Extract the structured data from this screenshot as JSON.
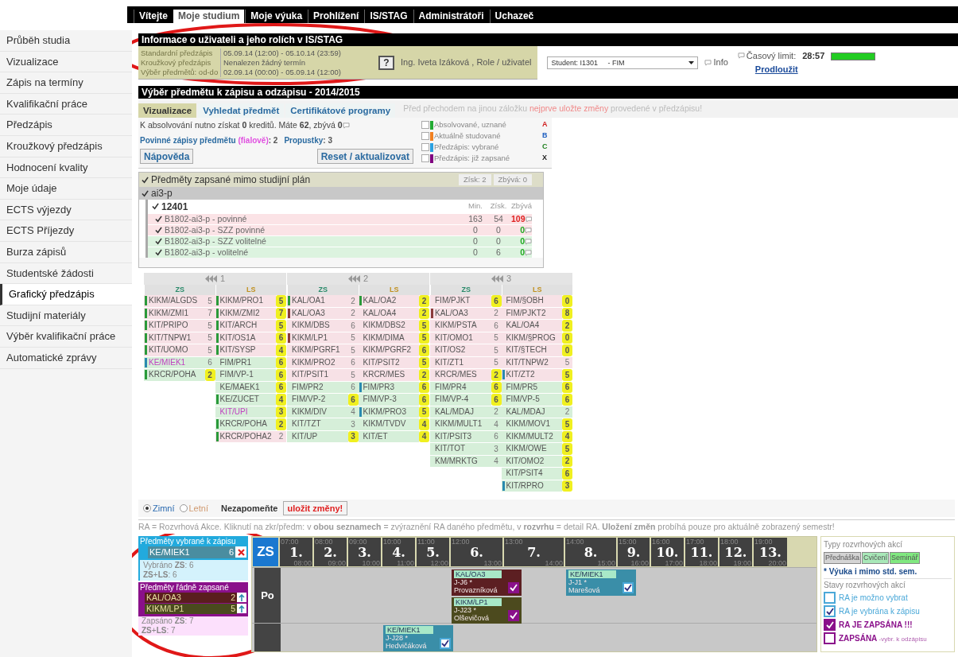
{
  "nav": {
    "tabs": [
      {
        "label": "Vítejte",
        "selected": false
      },
      {
        "label": "Moje studium",
        "selected": true
      },
      {
        "label": "Moje výuka",
        "selected": false
      },
      {
        "label": "Prohlížení",
        "selected": false
      },
      {
        "label": "IS/STAG",
        "selected": false
      },
      {
        "label": "Administrátoři",
        "selected": false
      },
      {
        "label": "Uchazeč",
        "selected": false
      }
    ]
  },
  "sidebar": {
    "items": [
      {
        "label": "Průběh studia",
        "selected": false
      },
      {
        "label": "Vizualizace",
        "selected": false
      },
      {
        "label": "Zápis na termíny",
        "selected": false
      },
      {
        "label": "Kvalifikační práce",
        "selected": false
      },
      {
        "label": "Předzápis",
        "selected": false
      },
      {
        "label": "Kroužkový předzápis",
        "selected": false
      },
      {
        "label": "Hodnocení kvality",
        "selected": false
      },
      {
        "label": "Moje údaje",
        "selected": false
      },
      {
        "label": "ECTS výjezdy",
        "selected": false
      },
      {
        "label": "ECTS Příjezdy",
        "selected": false
      },
      {
        "label": "Burza zápisů",
        "selected": false
      },
      {
        "label": "Studentské žádosti",
        "selected": false
      },
      {
        "label": "Grafický předzápis",
        "selected": true
      },
      {
        "label": "Studijní materiály",
        "selected": false
      },
      {
        "label": "Výběr kvalifikační práce",
        "selected": false
      },
      {
        "label": "Automatické zprávy",
        "selected": false
      }
    ]
  },
  "user_info": {
    "title": "Informace o uživateli a jeho rolích v IS/STAG",
    "periods": [
      {
        "label": "Standardní předzápis",
        "value": "05.09.14 (12:00) - 05.10.14 (23:59)"
      },
      {
        "label": "Kroužkový předzápis",
        "value": "Nenalezen žádný termín"
      },
      {
        "label": "Výběr předmětů: od-do",
        "value": "02.09.14 (00:00) - 05.09.14 (12:00)"
      }
    ],
    "help": "?",
    "user": "Ing. Iveta Izáková , Role / uživatel",
    "role_select": {
      "value": "Student: I1301     - FIM"
    },
    "info_link": "Info",
    "time_limit_label": "Časový limit:",
    "time_limit": "28:57",
    "time_bar": {
      "level": 1
    },
    "extend_link": "Prodloužit"
  },
  "selection": {
    "title": "Výběr předmětu k zápisu a odzápisu - 2014/2015",
    "tabs": [
      {
        "label": "Vizualizace",
        "selected": true
      },
      {
        "label": "Vyhledat předmět",
        "selected": false
      },
      {
        "label": "Certifikátové programy",
        "selected": false
      }
    ],
    "notice": {
      "before": "Před přechodem na jinou záložku",
      "highlight": "nejprve uložte změny",
      "after": "provedené v předzápisu!"
    },
    "credits_text": "K absolvování nutno získat **0** kreditů. Máte **62**, zbývá **0**",
    "required": {
      "label": "Povinné zápisy předmětu",
      "hint": "(fialově)",
      "value": ": 2"
    },
    "passes": {
      "label": "Propustky",
      "value": ": 3"
    },
    "buttons": [
      "Nápověda",
      "Reset / aktualizovat"
    ],
    "legend": [
      {
        "label": "Absolvované, uznané",
        "color": "#22aa33",
        "checked": false,
        "letter": "A"
      },
      {
        "label": "Aktuálně studované",
        "color": "#f08020",
        "checked": false,
        "letter": "B"
      },
      {
        "label": "Předzápis: vybrané",
        "color": "#2aa0e0",
        "checked": false,
        "letter": "C"
      },
      {
        "label": "Předzápis: již zapsané",
        "color": "#800080",
        "checked": false,
        "letter": "X"
      }
    ]
  },
  "tree": {
    "outside": {
      "label": "Předměty zapsané mimo studijní plán",
      "checked": true,
      "earned": "Získ: 2",
      "remaining": "Zbývá: 0"
    },
    "plan": {
      "label": "ai3-p",
      "checked": true
    },
    "block": {
      "label": "12401",
      "checked": true,
      "columns": [
        "Min.",
        "Získ.",
        "Zbývá"
      ],
      "rows": [
        {
          "label": "B1802-ai3-p - povinné",
          "checked": true,
          "color": "#fbe3e6",
          "min": "163",
          "earned": "54",
          "remaining": "109",
          "complete": false
        },
        {
          "label": "B1802-ai3-p - SZZ povinné",
          "checked": true,
          "color": "#fbe3e6",
          "min": "0",
          "earned": "0",
          "remaining": "0",
          "complete": true
        },
        {
          "label": "B1802-ai3-p - SZZ volitelné",
          "checked": true,
          "color": "#dcf3df",
          "min": "0",
          "earned": "0",
          "remaining": "0",
          "complete": true
        },
        {
          "label": "B1802-ai3-p - volitelné",
          "checked": true,
          "color": "#dcf3df",
          "min": "0",
          "earned": "6",
          "remaining": "0",
          "complete": true
        }
      ]
    }
  },
  "grid": {
    "years": [
      {
        "label": "1",
        "semesters": [
          {
            "label": "ZS",
            "courses": [
              {
                "code": "KIKM/ALGDS",
                "credits": "5",
                "color": "#f7e1e6",
                "badge": false,
                "marker": {
                  "color": "#2a9a3a"
                }
              },
              {
                "code": "KIKM/ZMI1",
                "credits": "7",
                "color": "#f7e1e6",
                "badge": false,
                "marker": {
                  "color": "#2a9a3a"
                }
              },
              {
                "code": "KIT/PRIPO",
                "credits": "5",
                "color": "#f7e1e6",
                "badge": false,
                "marker": {
                  "color": "#2a9a3a"
                }
              },
              {
                "code": "KIT/TNPW1",
                "credits": "5",
                "color": "#f7e1e6",
                "badge": false,
                "marker": {
                  "color": "#2a9a3a"
                }
              },
              {
                "code": "KIT/UOMO",
                "credits": "5",
                "color": "#f7e1e6",
                "badge": false,
                "marker": {
                  "color": "#2a9a3a"
                }
              },
              {
                "code": "KE/MIEK1",
                "credits": "6",
                "color": "#d6efd9",
                "badge": false,
                "marker": {
                  "color": "#2a8ab0"
                },
                "emphasis": true
              },
              {
                "code": "KRCR/POHA",
                "credits": "2",
                "color": "#d6efd9",
                "badge": true,
                "marker": {
                  "color": "#2a9a3a"
                }
              }
            ]
          },
          {
            "label": "LS",
            "courses": [
              {
                "code": "KIKM/PRO1",
                "credits": "5",
                "color": "#f7e1e6",
                "badge": true,
                "marker": {
                  "color": "#2a9a3a"
                }
              },
              {
                "code": "KIKM/ZMI2",
                "credits": "7",
                "color": "#f7e1e6",
                "badge": true,
                "marker": {
                  "color": "#2a9a3a"
                }
              },
              {
                "code": "KIT/ARCH",
                "credits": "5",
                "color": "#f7e1e6",
                "badge": true,
                "marker": {
                  "color": "#2a9a3a"
                }
              },
              {
                "code": "KIT/OS1A",
                "credits": "6",
                "color": "#f7e1e6",
                "badge": true,
                "marker": {
                  "color": "#2a9a3a"
                }
              },
              {
                "code": "KIT/SYSP",
                "credits": "4",
                "color": "#f7e1e6",
                "badge": true,
                "marker": {
                  "color": "#2a9a3a"
                }
              },
              {
                "code": "FIM/PR1",
                "credits": "6",
                "color": "#d6efd9",
                "badge": true
              },
              {
                "code": "FIM/VP-1",
                "credits": "6",
                "color": "#d6efd9",
                "badge": true
              },
              {
                "code": "KE/MAEK1",
                "credits": "6",
                "color": "#d6efd9",
                "badge": true
              },
              {
                "code": "KE/ZUCET",
                "credits": "4",
                "color": "#d6efd9",
                "badge": true,
                "marker": {
                  "color": "#2a9a3a"
                }
              },
              {
                "code": "KIT/UPI",
                "credits": "3",
                "color": "#d6efd9",
                "badge": true,
                "emphasis": true
              },
              {
                "code": "KRCR/POHA",
                "credits": "2",
                "color": "#d6efd9",
                "badge": true,
                "marker": {
                  "color": "#2a9a3a"
                }
              },
              {
                "code": "KRCR/POHA2",
                "credits": "2",
                "color": "#f7e1e6",
                "badge": false,
                "marker": {
                  "color": "#2a9a3a"
                }
              }
            ]
          }
        ]
      },
      {
        "label": "2",
        "semesters": [
          {
            "label": "ZS",
            "courses": [
              {
                "code": "KAL/OA1",
                "credits": "2",
                "color": "#f7e1e6",
                "badge": false,
                "marker": {
                  "color": "#2a9a3a"
                }
              },
              {
                "code": "KAL/OA3",
                "credits": "2",
                "color": "#f7e1e6",
                "badge": false,
                "marker": {
                  "color": "#8a3a3a"
                }
              },
              {
                "code": "KIKM/DBS",
                "credits": "6",
                "color": "#f7e1e6",
                "badge": false
              },
              {
                "code": "KIKM/LP1",
                "credits": "5",
                "color": "#f7e1e6",
                "badge": false,
                "marker": {
                  "color": "#8a3a3a"
                }
              },
              {
                "code": "KIKM/PGRF1",
                "credits": "5",
                "color": "#f7e1e6",
                "badge": false
              },
              {
                "code": "KIKM/PRO2",
                "credits": "6",
                "color": "#f7e1e6",
                "badge": false
              },
              {
                "code": "KIT/PSIT1",
                "credits": "5",
                "color": "#f7e1e6",
                "badge": false
              },
              {
                "code": "FIM/PR2",
                "credits": "6",
                "color": "#d6efd9",
                "badge": false
              },
              {
                "code": "FIM/VP-2",
                "credits": "6",
                "color": "#d6efd9",
                "badge": true
              },
              {
                "code": "KIKM/DIV",
                "credits": "4",
                "color": "#d6efd9",
                "badge": false
              },
              {
                "code": "KIT/TZT",
                "credits": "3",
                "color": "#d6efd9",
                "badge": false
              },
              {
                "code": "KIT/UP",
                "credits": "3",
                "color": "#d6efd9",
                "badge": true
              }
            ]
          },
          {
            "label": "LS",
            "courses": [
              {
                "code": "KAL/OA2",
                "credits": "2",
                "color": "#f7e1e6",
                "badge": true,
                "marker": {
                  "color": "#2a9a3a"
                }
              },
              {
                "code": "KAL/OA4",
                "credits": "2",
                "color": "#f7e1e6",
                "badge": true
              },
              {
                "code": "KIKM/DBS2",
                "credits": "5",
                "color": "#f7e1e6",
                "badge": true
              },
              {
                "code": "KIKM/DIMA",
                "credits": "5",
                "color": "#f7e1e6",
                "badge": true
              },
              {
                "code": "KIKM/PGRF2",
                "credits": "6",
                "color": "#f7e1e6",
                "badge": true
              },
              {
                "code": "KIT/PSIT2",
                "credits": "5",
                "color": "#f7e1e6",
                "badge": true
              },
              {
                "code": "KRCR/MES",
                "credits": "2",
                "color": "#f7e1e6",
                "badge": true
              },
              {
                "code": "FIM/PR3",
                "credits": "6",
                "color": "#d6efd9",
                "badge": true,
                "marker": {
                  "color": "#2a8ab0"
                }
              },
              {
                "code": "FIM/VP-3",
                "credits": "6",
                "color": "#d6efd9",
                "badge": true
              },
              {
                "code": "KIKM/PRO3",
                "credits": "5",
                "color": "#d6efd9",
                "badge": true,
                "marker": {
                  "color": "#2a8ab0"
                }
              },
              {
                "code": "KIKM/TVDV",
                "credits": "4",
                "color": "#d6efd9",
                "badge": true
              },
              {
                "code": "KIT/ET",
                "credits": "4",
                "color": "#d6efd9",
                "badge": true
              }
            ]
          }
        ]
      },
      {
        "label": "3",
        "semesters": [
          {
            "label": "ZS",
            "courses": [
              {
                "code": "FIM/PJKT",
                "credits": "6",
                "color": "#f7e1e6",
                "badge": true
              },
              {
                "code": "KAL/OA3",
                "credits": "2",
                "color": "#f7e1e6",
                "badge": false,
                "marker": {
                  "color": "#8a3a3a"
                }
              },
              {
                "code": "KIKM/PSTA",
                "credits": "6",
                "color": "#f7e1e6",
                "badge": false
              },
              {
                "code": "KIT/OMO1",
                "credits": "5",
                "color": "#f7e1e6",
                "badge": false
              },
              {
                "code": "KIT/OS2",
                "credits": "5",
                "color": "#f7e1e6",
                "badge": false
              },
              {
                "code": "KIT/ZT1",
                "credits": "5",
                "color": "#f7e1e6",
                "badge": false
              },
              {
                "code": "KRCR/MES",
                "credits": "2",
                "color": "#f7e1e6",
                "badge": true
              },
              {
                "code": "FIM/PR4",
                "credits": "6",
                "color": "#d6efd9",
                "badge": true
              },
              {
                "code": "FIM/VP-4",
                "credits": "6",
                "color": "#d6efd9",
                "badge": true
              },
              {
                "code": "KAL/MDAJ",
                "credits": "2",
                "color": "#d6efd9",
                "badge": false
              },
              {
                "code": "KIKM/MULT1",
                "credits": "4",
                "color": "#d6efd9",
                "badge": false
              },
              {
                "code": "KIT/PSIT3",
                "credits": "6",
                "color": "#d6efd9",
                "badge": false
              },
              {
                "code": "KIT/TOT",
                "credits": "3",
                "color": "#d6efd9",
                "badge": false
              },
              {
                "code": "KM/MRKTG",
                "credits": "4",
                "color": "#d6efd9",
                "badge": false
              }
            ]
          },
          {
            "label": "LS",
            "courses": [
              {
                "code": "FIM/§OBH",
                "credits": "0",
                "color": "#f7e1e6",
                "badge": true
              },
              {
                "code": "FIM/PJKT2",
                "credits": "8",
                "color": "#f7e1e6",
                "badge": true
              },
              {
                "code": "KAL/OA4",
                "credits": "2",
                "color": "#f7e1e6",
                "badge": true
              },
              {
                "code": "KIKM/§PROG",
                "credits": "0",
                "color": "#f7e1e6",
                "badge": true
              },
              {
                "code": "KIT/§TECH",
                "credits": "0",
                "color": "#f7e1e6",
                "badge": true
              },
              {
                "code": "KIT/TNPW2",
                "credits": "5",
                "color": "#f7e1e6",
                "badge": false
              },
              {
                "code": "KIT/ZT2",
                "credits": "5",
                "color": "#f7e1e6",
                "badge": true,
                "marker": {
                  "color": "#2a8ab0"
                }
              },
              {
                "code": "FIM/PR5",
                "credits": "6",
                "color": "#d6efd9",
                "badge": true
              },
              {
                "code": "FIM/VP-5",
                "credits": "6",
                "color": "#d6efd9",
                "badge": true
              },
              {
                "code": "KAL/MDAJ",
                "credits": "2",
                "color": "#d6efd9",
                "badge": false
              },
              {
                "code": "KIKM/MOV1",
                "credits": "5",
                "color": "#d6efd9",
                "badge": true
              },
              {
                "code": "KIKM/MULT2",
                "credits": "4",
                "color": "#d6efd9",
                "badge": true
              },
              {
                "code": "KIKM/OWE",
                "credits": "5",
                "color": "#d6efd9",
                "badge": true
              },
              {
                "code": "KIT/OMO2",
                "credits": "2",
                "color": "#d6efd9",
                "badge": true
              },
              {
                "code": "KIT/PSIT4",
                "credits": "6",
                "color": "#d6efd9",
                "badge": true
              },
              {
                "code": "KIT/RPRO",
                "credits": "3",
                "color": "#d6efd9",
                "badge": true,
                "marker": {
                  "color": "#2a8ab0"
                }
              }
            ]
          }
        ]
      }
    ]
  },
  "semester_choice": {
    "options": [
      {
        "label": "Zimní",
        "selected": true
      },
      {
        "label": "Letní",
        "selected": false
      }
    ],
    "reminder": "Nezapomeňte",
    "save_button": "uložit změny!"
  },
  "hint": "RA = Rozvrhová Akce. Kliknutí na zkr/předm: v **obou seznamech** = zvýraznění RA daného předmětu, v **rozvrhu** = detail RA. **Uložení změn** probíhá pouze pro aktuálně zobrazený semestr!",
  "schedule": {
    "chosen": {
      "title": "Předměty vybrané k zápisu",
      "items": [
        {
          "code": "KE/MIEK1",
          "credits": "6",
          "color": "#4a8da0"
        }
      ],
      "summary": [
        "Vybráno **ZS**: 6",
        "**ZS**+**LS**: 6"
      ]
    },
    "enrolled": {
      "title": "Předměty řádně zapsané",
      "items": [
        {
          "code": "KAL/OA3",
          "credits": "2",
          "color": "#5a1e1e"
        },
        {
          "code": "KIKM/LP1",
          "credits": "5",
          "color": "#4a4a1e"
        }
      ],
      "summary": [
        "Zapsáno **ZS**: 7",
        "**ZS**+**LS**: 7"
      ]
    },
    "semester": "ZS",
    "hours": [
      {
        "label": "1.",
        "start": "07:00",
        "end": "08:00"
      },
      {
        "label": "2.",
        "start": "08:00",
        "end": "09:00"
      },
      {
        "label": "3.",
        "start": "09:00",
        "end": "10:00"
      },
      {
        "label": "4.",
        "start": "10:00",
        "end": "11:00"
      },
      {
        "label": "5.",
        "start": "11:00",
        "end": "12:00"
      },
      {
        "label": "6.",
        "start": "12:00",
        "end": "13:00"
      },
      {
        "label": "7.",
        "start": "13:00",
        "end": "14:00"
      },
      {
        "label": "8.",
        "start": "14:00",
        "end": "15:00"
      },
      {
        "label": "9.",
        "start": "15:00",
        "end": "16:00"
      },
      {
        "label": "10.",
        "start": "16:00",
        "end": "17:00"
      },
      {
        "label": "11.",
        "start": "17:00",
        "end": "18:00"
      },
      {
        "label": "12.",
        "start": "18:00",
        "end": "19:00"
      },
      {
        "label": "13.",
        "start": "19:00",
        "end": "20:00"
      }
    ],
    "days": [
      {
        "label": "Po",
        "events": [
          {
            "code": "KAL/OA3",
            "room": "J-J6 *",
            "teacher": "Provazníková",
            "kind": "enrolled",
            "color": "#5c1f22"
          },
          {
            "code": "KIKM/LP1",
            "room": "J-J23 *",
            "teacher": "Olševičová",
            "kind": "enrolled",
            "color": "#4c4a1e"
          },
          {
            "code": "KE/MIEK1",
            "room": "J-J1 *",
            "teacher": "Marešová",
            "kind": "selected",
            "color": "#3a8ea8"
          }
        ]
      },
      {
        "events": [
          {
            "code": "KE/MIEK1",
            "room": "J-J28 *",
            "teacher": "Hedvičáková",
            "kind": "selected",
            "color": "#3a8ea8"
          }
        ]
      }
    ],
    "legend": {
      "types_title": "Typy rozvrhových akcí",
      "types": [
        {
          "label": "Přednáška",
          "color": "#d4d4d4"
        },
        {
          "label": "Cvičení",
          "color": "#a8e8b8"
        },
        {
          "label": "Seminář",
          "color": "#80e880"
        }
      ],
      "note": "* Výuka i mimo std. sem.",
      "states_title": "Stavy rozvrhových akcí",
      "states": [
        {
          "kind": "available",
          "label": "RA je možno vybrat"
        },
        {
          "kind": "selected",
          "label": "RA je vybrána k zápisu"
        },
        {
          "kind": "enrolled",
          "label": "RA JE ZAPSÁNA !!!"
        },
        {
          "kind": "unenroll",
          "label": "ZAPSÁNA",
          "suffix": "-vybr. k odzápisu"
        }
      ]
    }
  },
  "annotations": [
    {
      "kind": "ellipse",
      "color": "#e01818"
    },
    {
      "kind": "ellipse",
      "color": "#e01818"
    }
  ]
}
